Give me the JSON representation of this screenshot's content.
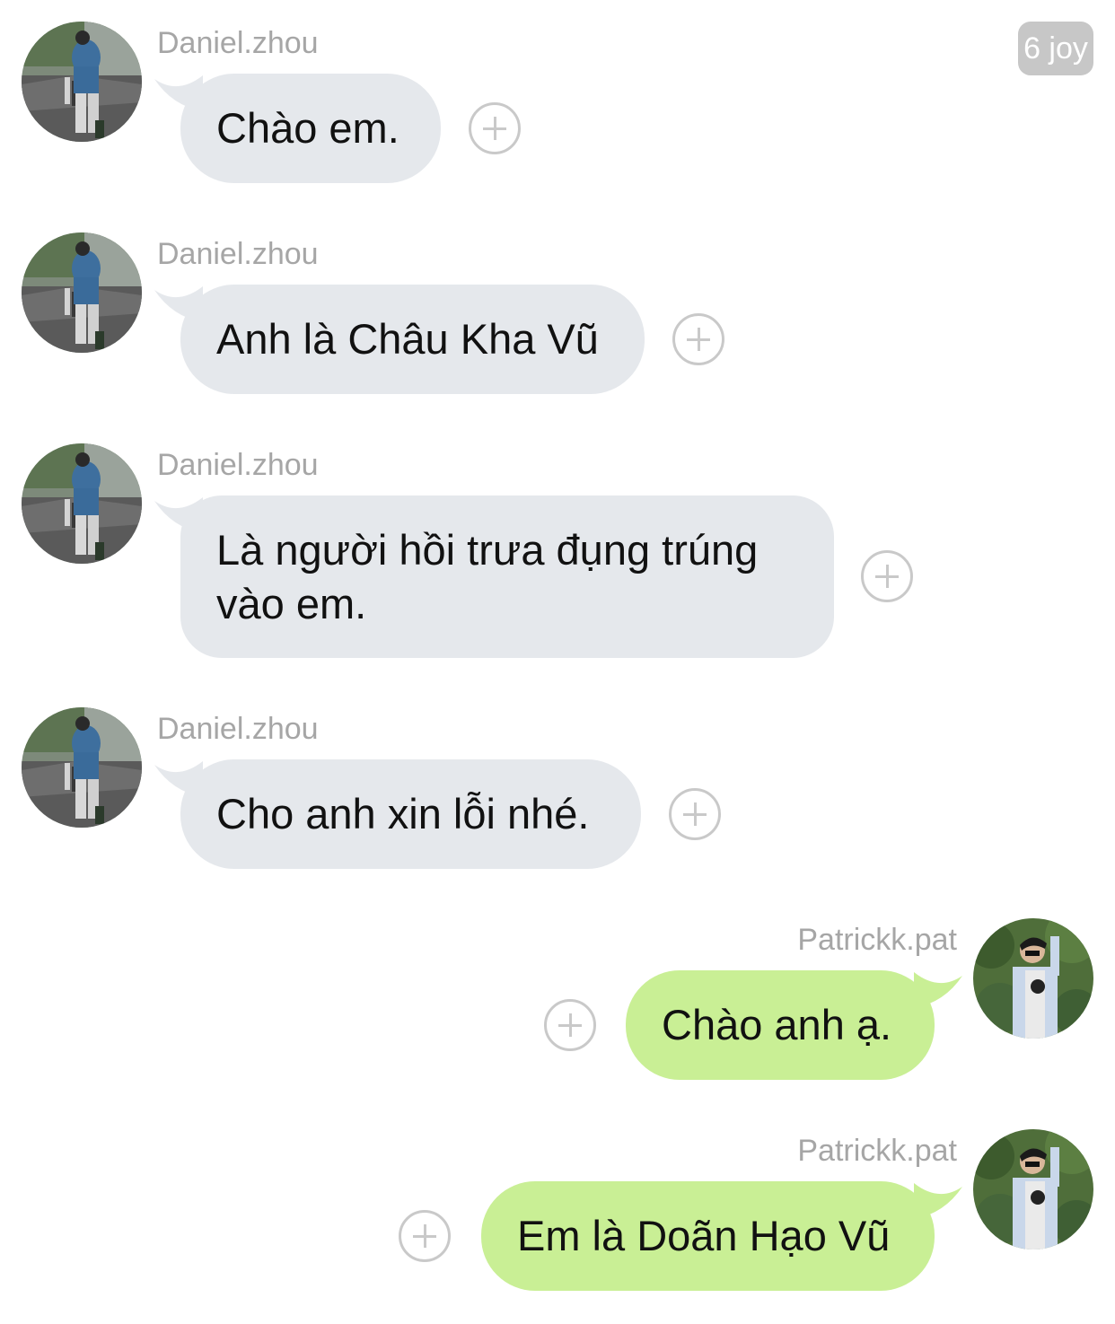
{
  "badge": {
    "text": "6 joy"
  },
  "messages": [
    {
      "sender": "Daniel.zhou",
      "direction": "incoming",
      "text": "Chào em."
    },
    {
      "sender": "Daniel.zhou",
      "direction": "incoming",
      "text": "Anh là Châu Kha Vũ"
    },
    {
      "sender": "Daniel.zhou",
      "direction": "incoming",
      "lines": [
        "Là người hồi trưa đụng trúng",
        "vào em."
      ]
    },
    {
      "sender": "Daniel.zhou",
      "direction": "incoming",
      "text": "Cho anh xin lỗi nhé."
    },
    {
      "sender": "Patrickk.pat",
      "direction": "outgoing",
      "text": "Chào anh ạ."
    },
    {
      "sender": "Patrickk.pat",
      "direction": "outgoing",
      "text": "Em là Doãn Hạo Vũ"
    }
  ],
  "colors": {
    "incoming_bubble": "#e5e8ec",
    "outgoing_bubble": "#c9ef95",
    "sender_name": "#a6a6a6",
    "badge_bg": "#c7c7c7"
  },
  "icons": {
    "add_reaction": "plus-circle-icon",
    "avatar_incoming": "avatar-photo-street",
    "avatar_outgoing": "avatar-photo-garden"
  }
}
